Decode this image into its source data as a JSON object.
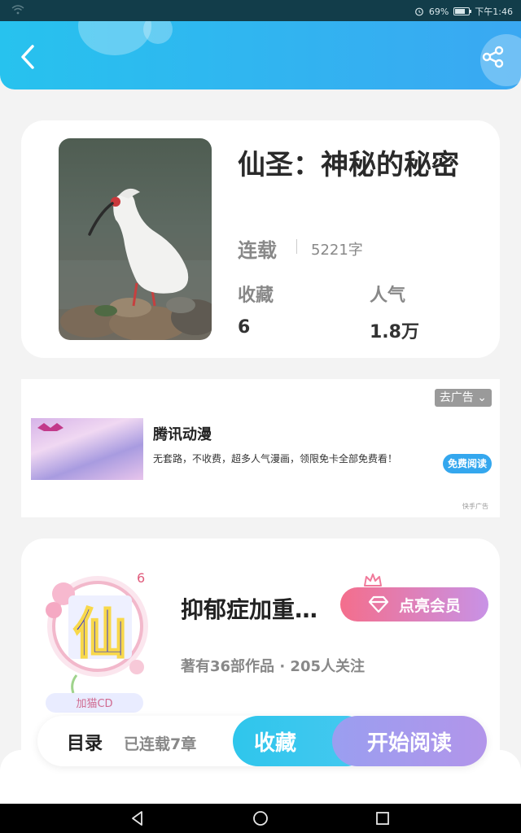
{
  "status_bar": {
    "battery_text": "69%",
    "time": "下午1:46",
    "battery_level": 0.69
  },
  "header": {
    "back_icon": "chevron-left-icon",
    "share_icon": "share-icon"
  },
  "book": {
    "title": "仙圣：神秘的秘密",
    "status": "连载",
    "word_count": "5221字",
    "favorites_label": "收藏",
    "favorites_value": "6",
    "popularity_label": "人气",
    "popularity_value": "1.8万"
  },
  "ad": {
    "close_label": "去广告",
    "title": "腾讯动漫",
    "description": "无套路，不收费，超多人气漫画，领限免卡全部免费看！",
    "cta_label": "免费阅读",
    "source": "快手广告"
  },
  "author": {
    "avatar_char": "仙",
    "avatar_badge": "加猫CD",
    "avatar_number": "6",
    "name": "抑郁症加重…",
    "vip_label": "点亮会员",
    "meta": "著有36部作品 · 205人关注"
  },
  "action_bar": {
    "toc_label": "目录",
    "chapters_label": "已连载7章",
    "favorite_label": "收藏",
    "read_label": "开始阅读"
  },
  "colors": {
    "header": "#27c2ee",
    "accent": "#34a7ee",
    "vip": "#f46e8c"
  }
}
